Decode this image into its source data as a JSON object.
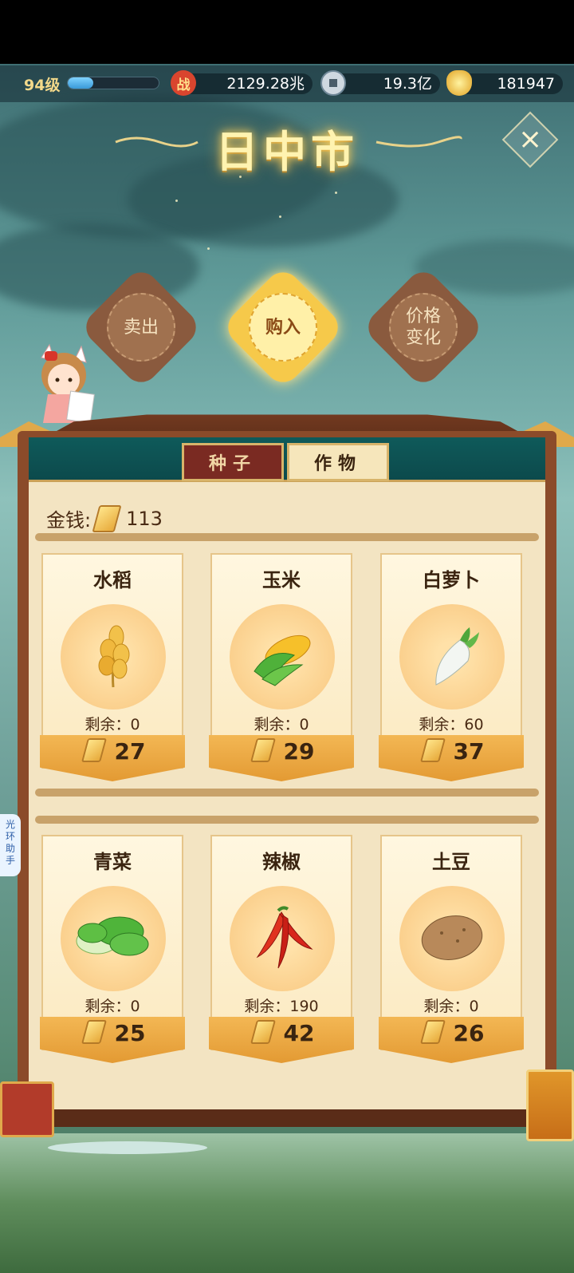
{
  "status": {
    "level": "94级",
    "xp_fraction": 0.28,
    "power_icon": "战",
    "power": "2129.28兆",
    "silver": "19.3亿",
    "gold": "181947"
  },
  "title": "日中市",
  "modes": {
    "sell": "卖出",
    "buy": "购入",
    "price": "价格\n变化"
  },
  "tabs": {
    "seed": "种子",
    "crop": "作物",
    "active": "crop"
  },
  "money_label": "金钱:",
  "money_value": "113",
  "side_helper": "光\n环\n助\n手",
  "crops": [
    {
      "name": "水稻",
      "remain": "剩余：0",
      "price": "27",
      "icon": "rice-icon"
    },
    {
      "name": "玉米",
      "remain": "剩余：0",
      "price": "29",
      "icon": "corn-icon"
    },
    {
      "name": "白萝卜",
      "remain": "剩余：60",
      "price": "37",
      "icon": "radish-icon"
    },
    {
      "name": "青菜",
      "remain": "剩余：0",
      "price": "25",
      "icon": "bokchoy-icon"
    },
    {
      "name": "辣椒",
      "remain": "剩余：190",
      "price": "42",
      "icon": "chili-icon"
    },
    {
      "name": "土豆",
      "remain": "剩余：0",
      "price": "26",
      "icon": "potato-icon"
    }
  ],
  "colors": {
    "accent_gold": "#f6c94a",
    "frame_brown": "#8b4b2a",
    "paper": "#f3e4c2",
    "tab_active": "#f6e6bb",
    "tab_inactive": "#7a2a22"
  }
}
